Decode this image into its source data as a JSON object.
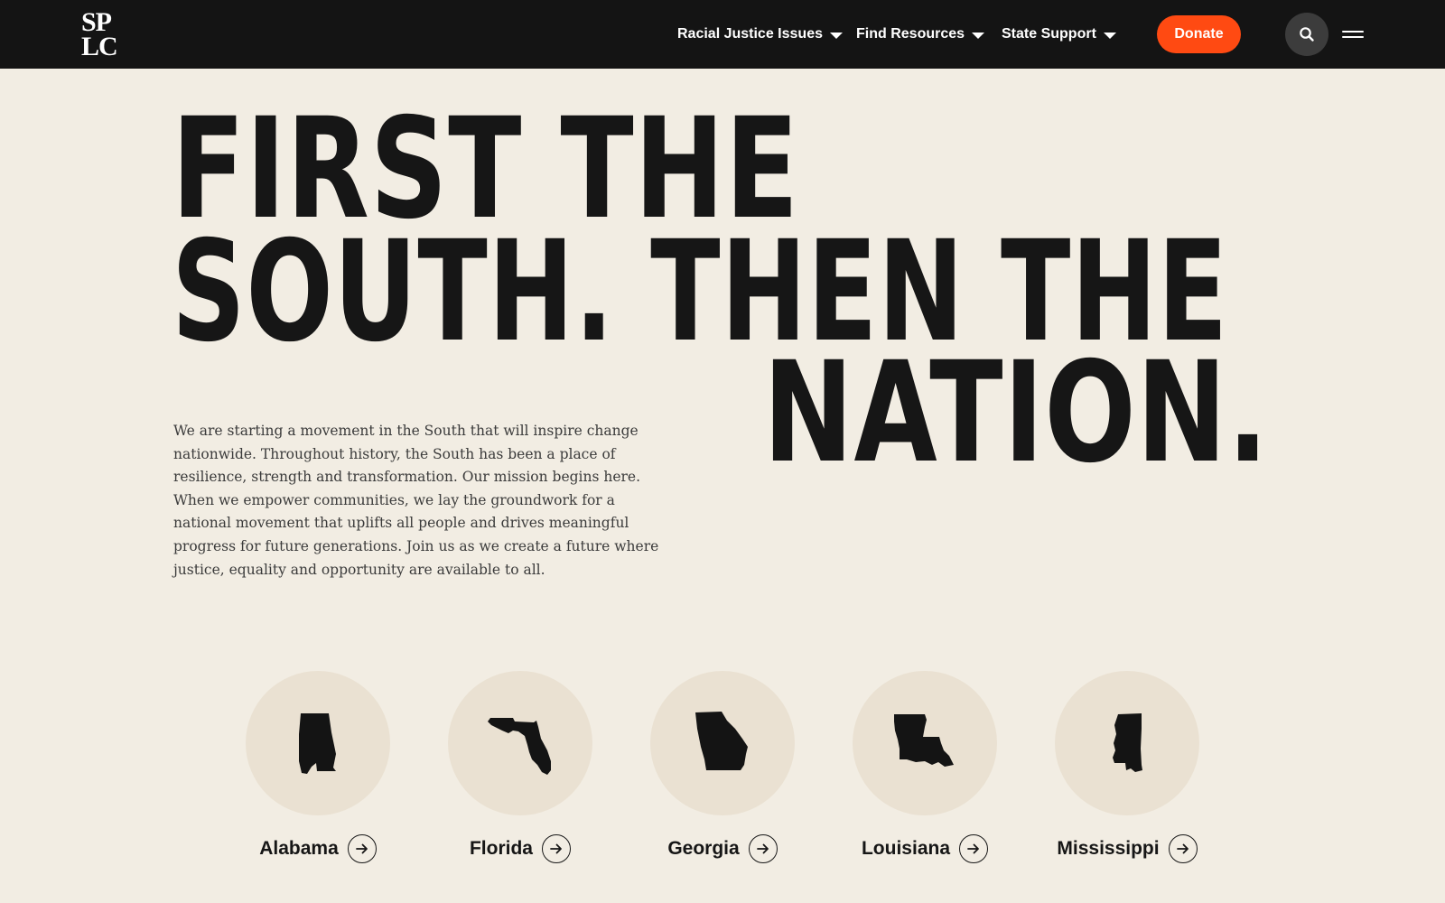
{
  "header": {
    "logo_line1": "SP",
    "logo_line2": "LC",
    "nav": [
      {
        "label": "Racial Justice Issues"
      },
      {
        "label": "Find Resources"
      },
      {
        "label": "State Support"
      }
    ],
    "donate_label": "Donate",
    "colors": {
      "bar": "#141414",
      "donate": "#ff4a12",
      "search": "#3c3c3c"
    }
  },
  "hero": {
    "line1": "FIRST THE",
    "line2": "SOUTH. THEN THE",
    "line3": "NATION.",
    "intro": "We are starting a movement in the South that will inspire change nationwide. Throughout history, the South has been a place of resilience, strength and transformation. Our mission begins here. When we empower communities, we lay the groundwork for a national movement that uplifts all people and drives meaningful progress for future generations. Join us as we create a future where justice, equality and opportunity are available to all."
  },
  "states": [
    {
      "name": "Alabama",
      "icon": "alabama-map-icon"
    },
    {
      "name": "Florida",
      "icon": "florida-map-icon"
    },
    {
      "name": "Georgia",
      "icon": "georgia-map-icon"
    },
    {
      "name": "Louisiana",
      "icon": "louisiana-map-icon"
    },
    {
      "name": "Mississippi",
      "icon": "mississippi-map-icon"
    }
  ]
}
